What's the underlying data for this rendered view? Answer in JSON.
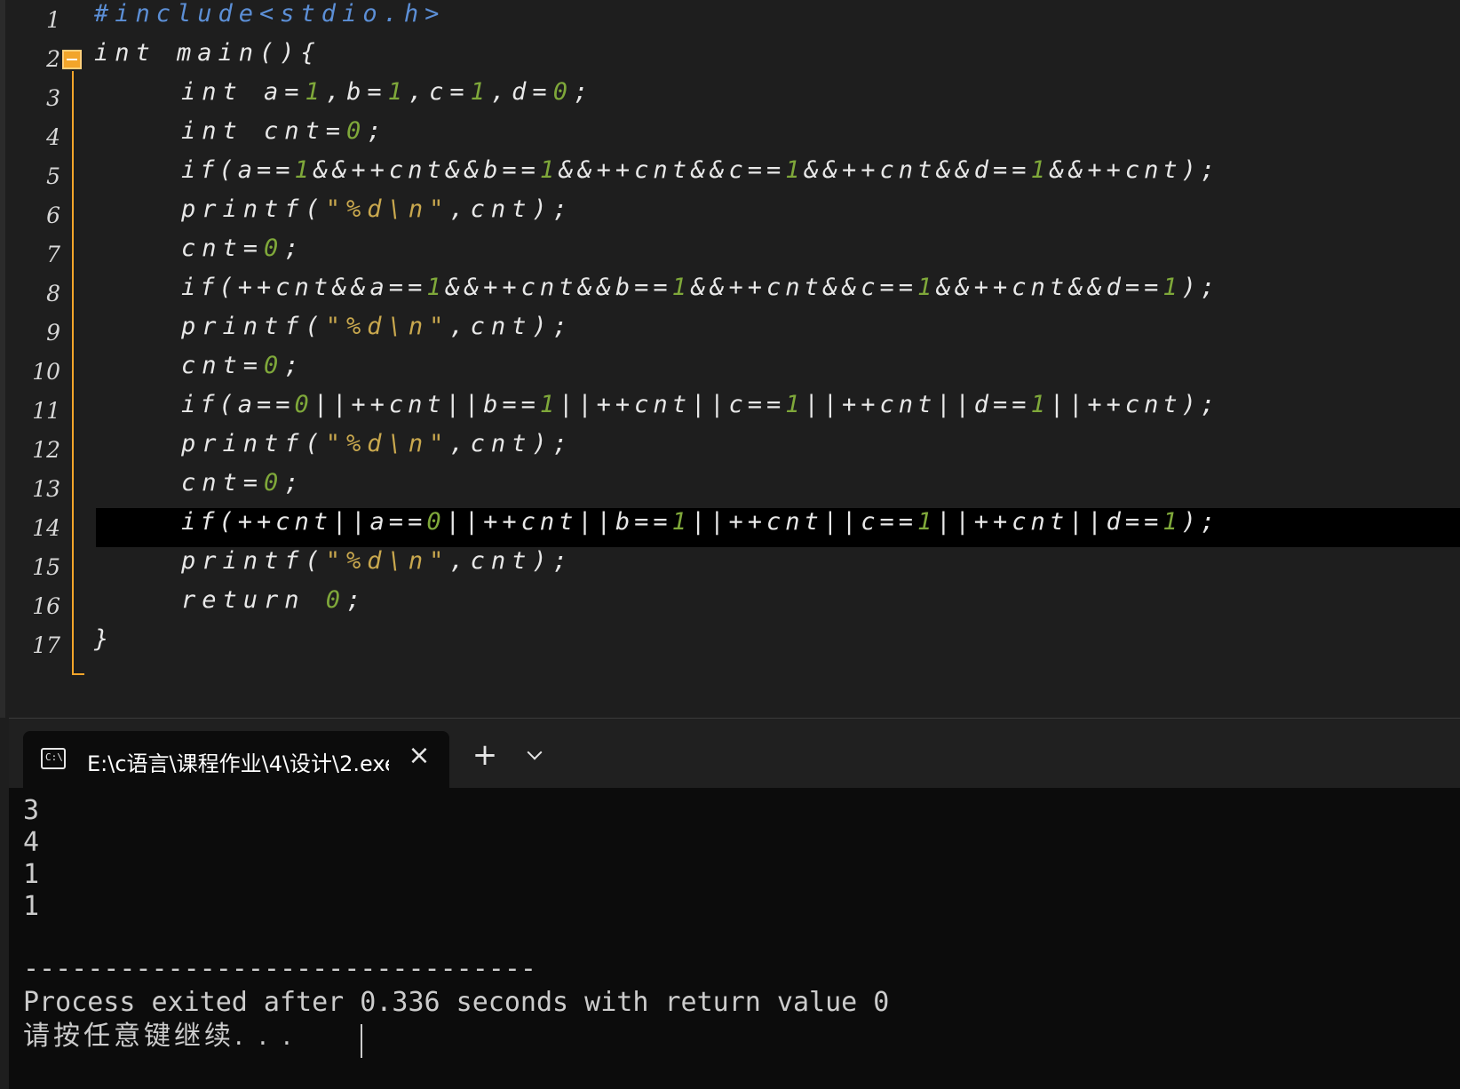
{
  "editor": {
    "lines": [
      {
        "number": "1",
        "text": "#include<stdio.h>"
      },
      {
        "number": "2",
        "text": "int main(){"
      },
      {
        "number": "3",
        "text": "int a=1,b=1,c=1,d=0;"
      },
      {
        "number": "4",
        "text": "int cnt=0;"
      },
      {
        "number": "5",
        "text": "if(a==1&&++cnt&&b==1&&++cnt&&c==1&&++cnt&&d==1&&++cnt);"
      },
      {
        "number": "6",
        "text": "printf(\"%d\\n\",cnt);"
      },
      {
        "number": "7",
        "text": "cnt=0;"
      },
      {
        "number": "8",
        "text": "if(++cnt&&a==1&&++cnt&&b==1&&++cnt&&c==1&&++cnt&&d==1);"
      },
      {
        "number": "9",
        "text": "printf(\"%d\\n\",cnt);"
      },
      {
        "number": "10",
        "text": "cnt=0;"
      },
      {
        "number": "11",
        "text": "if(a==0||++cnt||b==1||++cnt||c==1||++cnt||d==1||++cnt);"
      },
      {
        "number": "12",
        "text": "printf(\"%d\\n\",cnt);"
      },
      {
        "number": "13",
        "text": "cnt=0;"
      },
      {
        "number": "14",
        "text": "if(++cnt||a==0||++cnt||b==1||++cnt||c==1||++cnt||d==1);"
      },
      {
        "number": "15",
        "text": "printf(\"%d\\n\",cnt);"
      },
      {
        "number": "16",
        "text": "return 0;"
      },
      {
        "number": "17",
        "text": "}"
      }
    ],
    "current_line": "14",
    "colors": {
      "number": "#7fa83a",
      "preprocessor": "#5c8fd6",
      "string": "#c9a84e",
      "fold": "#f2a52a"
    }
  },
  "terminal": {
    "tab_title": "E:\\c语言\\课程作业\\4\\设计\\2.exe",
    "tab_icon_label": "C:\\",
    "close_icon": "×",
    "new_tab_icon": "+",
    "output_lines": [
      "3",
      "4",
      "1",
      "1",
      "",
      "--------------------------------",
      "Process exited after 0.336 seconds with return value 0",
      "请按任意键继续. . ."
    ]
  }
}
